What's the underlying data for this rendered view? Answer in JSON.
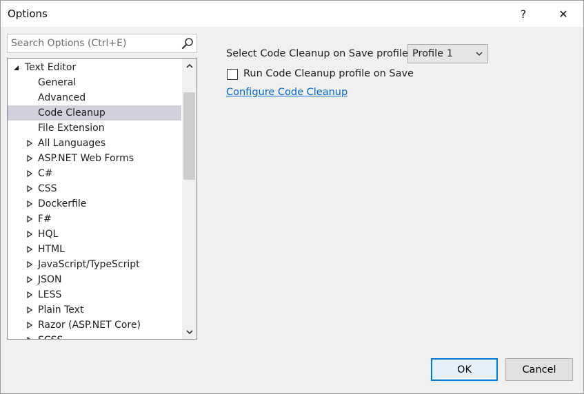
{
  "window": {
    "title": "Options"
  },
  "titlebar": {
    "help_label": "?",
    "close_label": "✕"
  },
  "search": {
    "placeholder": "Search Options (Ctrl+E)",
    "value": ""
  },
  "tree": {
    "items": [
      {
        "label": "Text Editor",
        "level": 0,
        "expander": "expanded"
      },
      {
        "label": "General",
        "level": 1,
        "expander": "none"
      },
      {
        "label": "Advanced",
        "level": 1,
        "expander": "none"
      },
      {
        "label": "Code Cleanup",
        "level": 1,
        "expander": "none",
        "selected": true
      },
      {
        "label": "File Extension",
        "level": 1,
        "expander": "none"
      },
      {
        "label": "All Languages",
        "level": 1,
        "expander": "collapsed"
      },
      {
        "label": "ASP.NET Web Forms",
        "level": 1,
        "expander": "collapsed"
      },
      {
        "label": "C#",
        "level": 1,
        "expander": "collapsed"
      },
      {
        "label": "CSS",
        "level": 1,
        "expander": "collapsed"
      },
      {
        "label": "Dockerfile",
        "level": 1,
        "expander": "collapsed"
      },
      {
        "label": "F#",
        "level": 1,
        "expander": "collapsed"
      },
      {
        "label": "HQL",
        "level": 1,
        "expander": "collapsed"
      },
      {
        "label": "HTML",
        "level": 1,
        "expander": "collapsed"
      },
      {
        "label": "JavaScript/TypeScript",
        "level": 1,
        "expander": "collapsed"
      },
      {
        "label": "JSON",
        "level": 1,
        "expander": "collapsed"
      },
      {
        "label": "LESS",
        "level": 1,
        "expander": "collapsed"
      },
      {
        "label": "Plain Text",
        "level": 1,
        "expander": "collapsed"
      },
      {
        "label": "Razor (ASP.NET Core)",
        "level": 1,
        "expander": "collapsed"
      },
      {
        "label": "SCSS",
        "level": 1,
        "expander": "collapsed"
      }
    ]
  },
  "main": {
    "profile_label": "Select Code Cleanup on Save profile:",
    "profile_value": "Profile 1",
    "run_on_save_label": "Run Code Cleanup profile on Save",
    "run_on_save_checked": false,
    "configure_link": "Configure Code Cleanup"
  },
  "buttons": {
    "ok": "OK",
    "cancel": "Cancel"
  },
  "colors": {
    "selection": "#cfd0db",
    "link": "#0066cc",
    "default_button_border": "#0078d7"
  }
}
